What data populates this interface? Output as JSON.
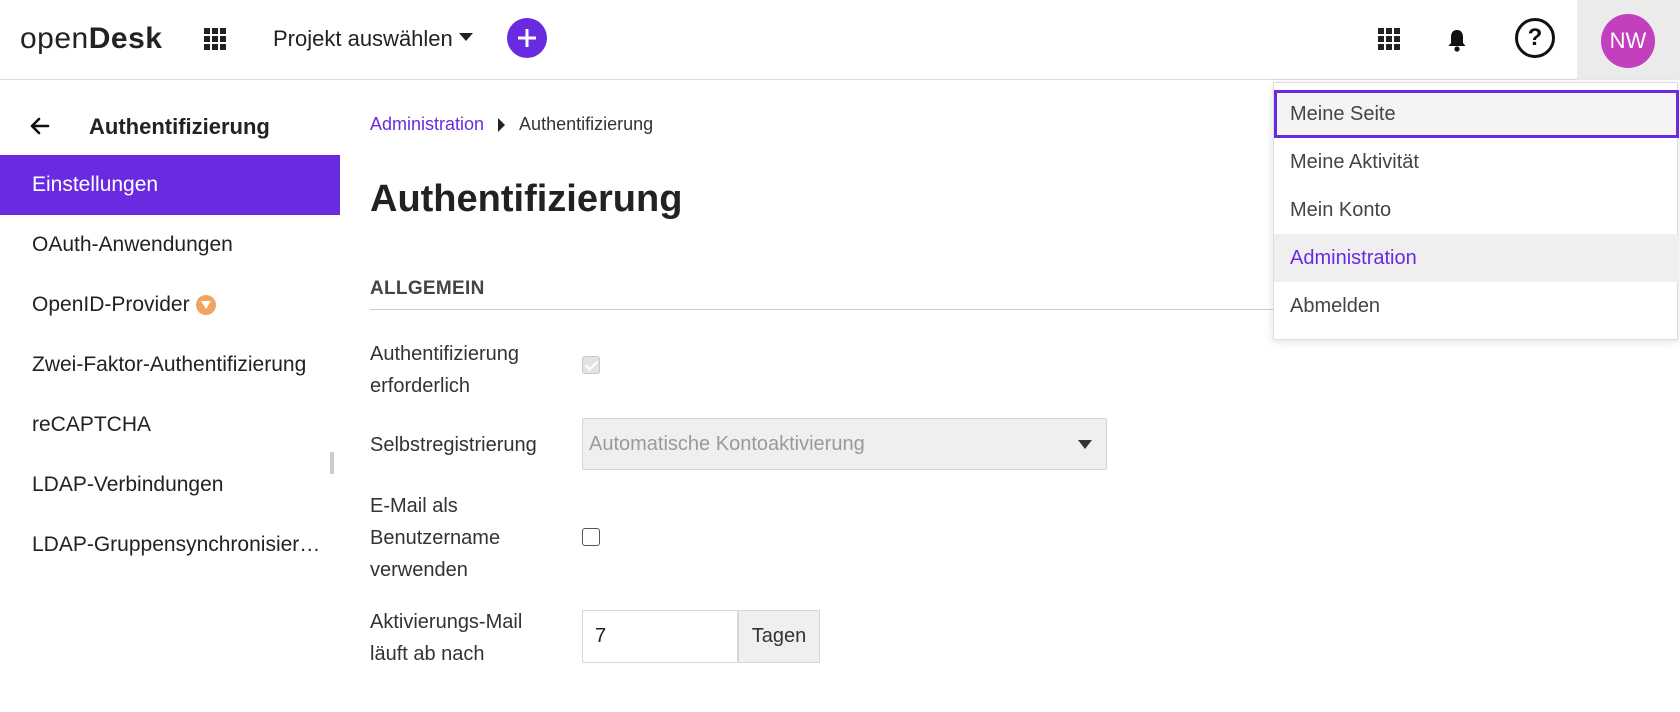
{
  "header": {
    "logo_light": "open",
    "logo_bold": "Desk",
    "apps_icon": "grid-icon",
    "project_select_label": "Projekt auswählen",
    "add_icon": "plus-icon",
    "modules_icon": "grid-icon",
    "notifications_icon": "bell-icon",
    "help_label": "?",
    "avatar_initials": "NW",
    "avatar_color": "#c23fbd",
    "accent_color": "#6a2be0"
  },
  "sidebar": {
    "title": "Authentifizierung",
    "back_icon": "arrow-left-icon",
    "items": [
      {
        "label": "Einstellungen",
        "active": true
      },
      {
        "label": "OAuth-Anwendungen"
      },
      {
        "label": "OpenID-Provider",
        "badge_icon": "enterprise-gem-icon"
      },
      {
        "label": "Zwei-Faktor-Authentifizierung"
      },
      {
        "label": "reCAPTCHA"
      },
      {
        "label": "LDAP-Verbindungen"
      },
      {
        "label": "LDAP-Gruppensynchronisieru..."
      }
    ]
  },
  "breadcrumb": {
    "link": "Administration",
    "current": "Authentifizierung"
  },
  "main": {
    "page_title": "Authentifizierung",
    "section_title": "ALLGEMEIN",
    "fields": {
      "auth_required": {
        "label_line1": "Authentifizierung",
        "label_line2": "erforderlich",
        "checked": true,
        "disabled": true
      },
      "self_registration": {
        "label": "Selbstregistrierung",
        "value": "Automatische Kontoaktivierung"
      },
      "email_as_login": {
        "label_line1": "E-Mail als",
        "label_line2": "Benutzername",
        "label_line3": "verwenden",
        "checked": false
      },
      "activation_mail": {
        "label_line1": "Aktivierungs-Mail",
        "label_line2": "läuft ab nach",
        "value": "7",
        "unit": "Tagen"
      }
    }
  },
  "user_menu": {
    "items": [
      {
        "label": "Meine Seite",
        "state": "focused"
      },
      {
        "label": "Meine Aktivität"
      },
      {
        "label": "Mein Konto"
      },
      {
        "label": "Administration",
        "state": "hover"
      },
      {
        "label": "Abmelden"
      }
    ]
  }
}
